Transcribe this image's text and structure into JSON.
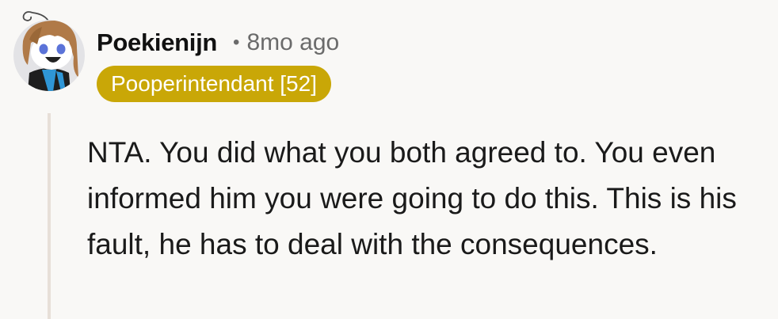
{
  "comment": {
    "author": "Poekienijn",
    "separator": "•",
    "timestamp": "8mo ago",
    "flair": {
      "text": "Pooperintendant [52]",
      "background": "#c9a707",
      "color": "#ffffff"
    },
    "body": "NTA. You did what you both agreed to. You even informed him you were going to do this. This is his fault, he has to deal with the consequences."
  },
  "colors": {
    "background": "#f9f8f6",
    "thread_line": "#e7dfd8",
    "meta_text": "#6b6b6b"
  },
  "icons": {
    "avatar": "snoo-avatar-icon"
  }
}
